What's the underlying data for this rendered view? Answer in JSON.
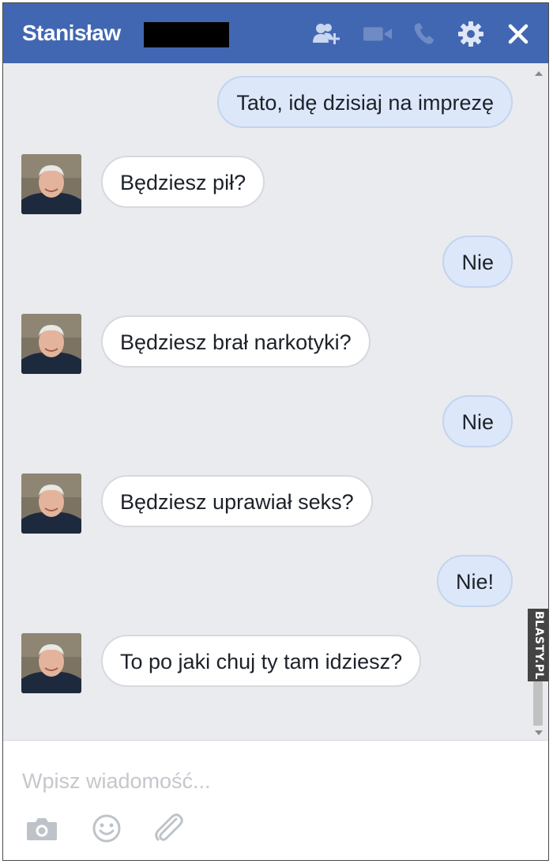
{
  "header": {
    "name": "Stanisław",
    "icons": [
      "add-people-icon",
      "video-camera-icon",
      "phone-icon",
      "gear-icon",
      "close-icon"
    ],
    "background": "#4267b2"
  },
  "messages": [
    {
      "side": "out",
      "text": "Tato, idę dzisiaj na imprezę"
    },
    {
      "side": "in",
      "text": "Będziesz pił?"
    },
    {
      "side": "out",
      "text": "Nie"
    },
    {
      "side": "in",
      "text": "Będziesz brał narkotyki?"
    },
    {
      "side": "out",
      "text": "Nie"
    },
    {
      "side": "in",
      "text": "Będziesz uprawiał seks?"
    },
    {
      "side": "out",
      "text": "Nie!"
    },
    {
      "side": "in",
      "text": "To po jaki chuj ty tam idziesz?"
    }
  ],
  "watermark": "BLASTY.PL",
  "composer": {
    "placeholder": "Wpisz wiadomość...",
    "icons": [
      "camera-icon",
      "emoji-icon",
      "paperclip-icon"
    ]
  },
  "colors": {
    "outgoing_bubble": "#dce8fa",
    "incoming_bubble": "#ffffff",
    "chat_background": "#e9ebee"
  }
}
